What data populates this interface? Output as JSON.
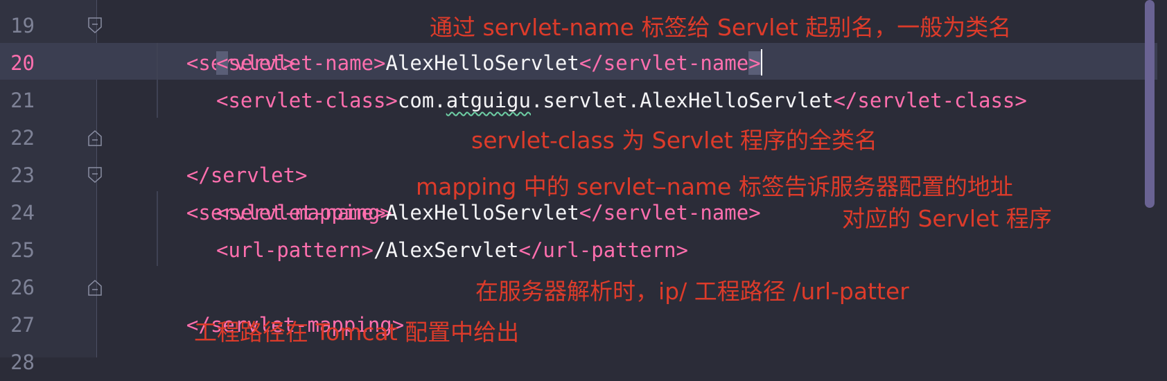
{
  "editor": {
    "current_line": 20,
    "lines": [
      {
        "num": "19"
      },
      {
        "num": "20"
      },
      {
        "num": "21"
      },
      {
        "num": "22"
      },
      {
        "num": "23"
      },
      {
        "num": "24"
      },
      {
        "num": "25"
      },
      {
        "num": "26"
      },
      {
        "num": "27"
      },
      {
        "num": "28"
      }
    ],
    "code": {
      "l19": {
        "open": "<servlet>"
      },
      "l20": {
        "lt": "<",
        "name": "servlet-name",
        "gt1": ">",
        "value": "AlexHelloServlet",
        "close": "</servlet-name",
        "gt2": ">"
      },
      "l21": {
        "open": "<servlet-class>",
        "pkg_a": "com.",
        "pkg_b": "atguigu",
        "pkg_c": ".servlet.AlexHelloServlet",
        "close": "</servlet-class>"
      },
      "l22": {
        "close": "</servlet>"
      },
      "l23": {
        "open": "<servlet-mapping>"
      },
      "l24": {
        "open": "<servlet-name>",
        "value": "AlexHelloServlet",
        "close": "</servlet-name>"
      },
      "l25": {
        "open": "<url-pattern>",
        "value": "/AlexServlet",
        "close": "</url-pattern>"
      },
      "l26": {
        "close": "</servlet-mapping>"
      }
    }
  },
  "annotations": {
    "a1": "通过 servlet-name 标签给 Servlet 起别名，一般为类名",
    "a2": "servlet-class 为 Servlet 程序的全类名",
    "a3": "mapping 中的 servlet–name 标签告诉服务器配置的地址",
    "a4": "对应的 Servlet 程序",
    "a5": "在服务器解析时，ip/ 工程路径 /url-patter",
    "a6": "工程路径在 Tomcat 配置中给出"
  },
  "colors": {
    "background": "#2b2c38",
    "tag": "#ff6fae",
    "annotation": "#dd3b2a"
  }
}
